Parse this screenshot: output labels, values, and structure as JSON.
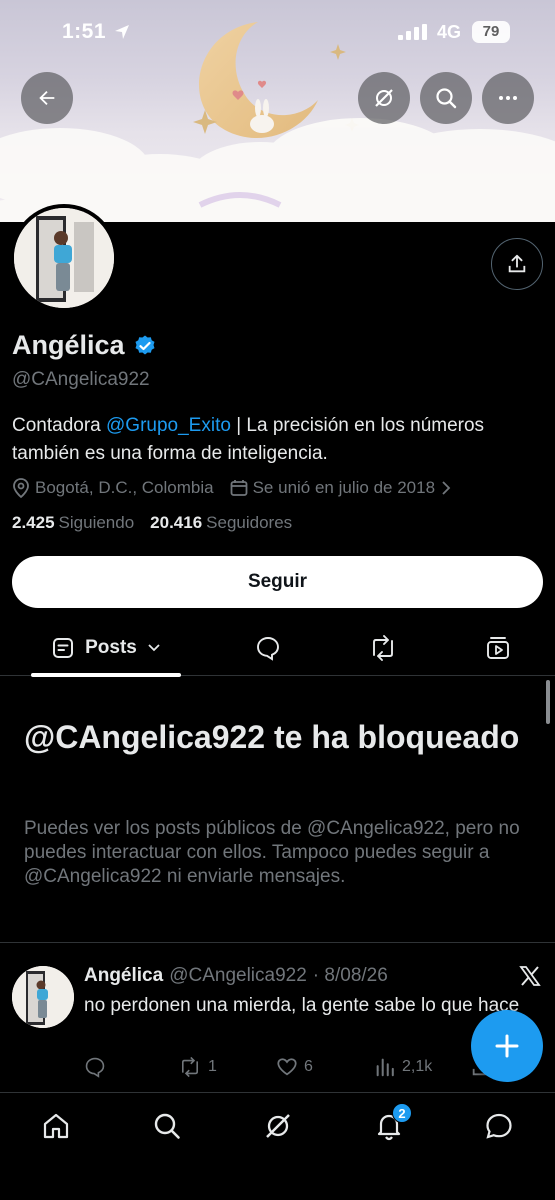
{
  "status_bar": {
    "time": "1:51",
    "network": "4G",
    "battery": "79"
  },
  "profile": {
    "name": "Angélica",
    "handle": "@CAngelica922",
    "bio_prefix": "Contadora ",
    "bio_mention": "@Grupo_Exito",
    "bio_suffix": " | La precisión en los números también es una forma de inteligencia.",
    "location": "Bogotá, D.C., Colombia",
    "joined": "Se unió en julio de 2018",
    "following_count": "2.425",
    "following_label": "Siguiendo",
    "followers_count": "20.416",
    "followers_label": "Seguidores",
    "follow_button": "Seguir"
  },
  "tabs": {
    "active_label": "Posts"
  },
  "blocked": {
    "title": "@CAngelica922 te ha bloqueado",
    "description": "Puedes ver los posts públicos de @CAngelica922, pero no puedes interactuar con ellos. Tampoco puedes seguir a @CAngelica922 ni enviarle mensajes."
  },
  "post": {
    "name": "Angélica",
    "handle": "@CAngelica922",
    "date": "· 8/08/26",
    "text": "no perdonen una mierda, la gente sabe lo que hace",
    "retweets": "1",
    "likes": "6",
    "views": "2,1k"
  },
  "bottom_nav": {
    "notifications_badge": "2"
  },
  "colors": {
    "accent": "#1d9bf0",
    "background": "#000000",
    "muted": "#71767b"
  }
}
